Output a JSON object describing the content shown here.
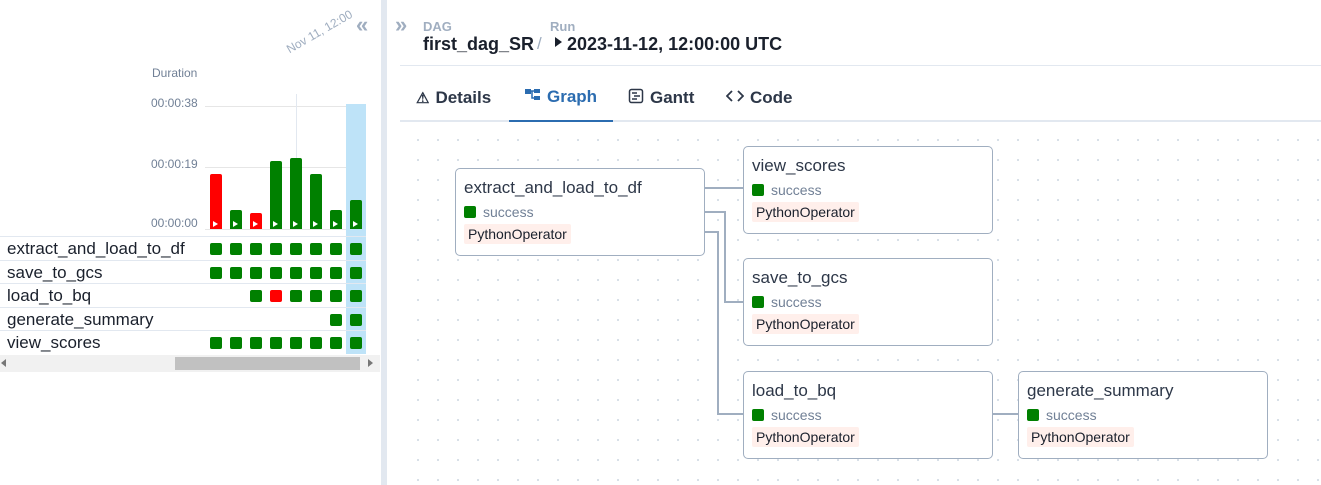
{
  "grid": {
    "duration_label": "Duration",
    "run_date_label": "Nov 11, 12:00",
    "y_ticks": [
      "00:00:38",
      "00:00:19",
      "00:00:00"
    ],
    "collapse_icon": "double-chevron-left-icon",
    "runs": [
      {
        "status": "failed",
        "duration_s": 17
      },
      {
        "status": "success",
        "duration_s": 6
      },
      {
        "status": "failed",
        "duration_s": 5
      },
      {
        "status": "success",
        "duration_s": 21
      },
      {
        "status": "success",
        "duration_s": 22
      },
      {
        "status": "success",
        "duration_s": 17
      },
      {
        "status": "success",
        "duration_s": 6
      },
      {
        "status": "success",
        "duration_s": 9
      }
    ],
    "tasks": [
      {
        "name": "extract_and_load_to_df",
        "cells": [
          "success",
          "success",
          "success",
          "success",
          "success",
          "success",
          "success",
          "success"
        ]
      },
      {
        "name": "save_to_gcs",
        "cells": [
          "success",
          "success",
          "success",
          "success",
          "success",
          "success",
          "success",
          "success"
        ]
      },
      {
        "name": "load_to_bq",
        "cells": [
          "",
          "",
          "success",
          "failed",
          "success",
          "success",
          "success",
          "success"
        ]
      },
      {
        "name": "generate_summary",
        "cells": [
          "",
          "",
          "",
          "",
          "",
          "",
          "success",
          "success"
        ]
      },
      {
        "name": "view_scores",
        "cells": [
          "success",
          "success",
          "success",
          "success",
          "success",
          "success",
          "success",
          "success"
        ]
      }
    ]
  },
  "colors": {
    "success": "#008000",
    "failed": "#ff0000",
    "selected": "#bee3f8",
    "accent": "#2b6cb0",
    "operator_bg": "#ffefeb"
  },
  "header": {
    "expand_icon": "double-chevron-right-icon",
    "dag_label": "DAG",
    "dag_value": "first_dag_SR",
    "separator": "/",
    "run_label": "Run",
    "run_value": "2023-11-12, 12:00:00 UTC"
  },
  "tabs": [
    {
      "id": "details",
      "label": "Details",
      "icon": "⚠"
    },
    {
      "id": "graph",
      "label": "Graph",
      "icon": "▚"
    },
    {
      "id": "gantt",
      "label": "Gantt",
      "icon": "▤"
    },
    {
      "id": "code",
      "label": "Code",
      "icon": "<>"
    }
  ],
  "graph": {
    "nodes": [
      {
        "id": "extract_and_load_to_df",
        "status": "success",
        "operator": "PythonOperator"
      },
      {
        "id": "view_scores",
        "status": "success",
        "operator": "PythonOperator"
      },
      {
        "id": "save_to_gcs",
        "status": "success",
        "operator": "PythonOperator"
      },
      {
        "id": "load_to_bq",
        "status": "success",
        "operator": "PythonOperator"
      },
      {
        "id": "generate_summary",
        "status": "success",
        "operator": "PythonOperator"
      }
    ]
  }
}
